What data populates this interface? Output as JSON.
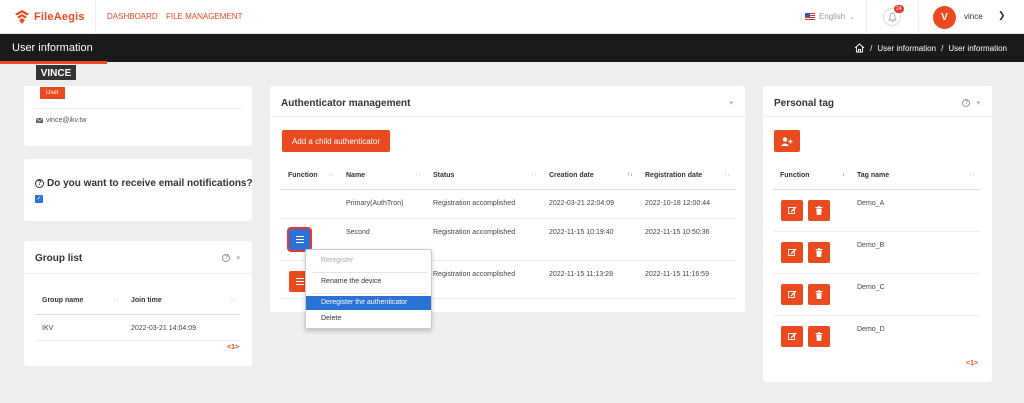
{
  "brand": {
    "name": "FileAegis",
    "accent": "#ea4a1f"
  },
  "nav": {
    "dashboard": "DASHBOARD",
    "file_management": "FILE MANAGEMENT"
  },
  "language": "English",
  "notifications": {
    "count": "24"
  },
  "user": {
    "initial": "V",
    "name": "vince",
    "display": "VINCE",
    "role": "User",
    "email": "vince@ikv.tw"
  },
  "page": {
    "title": "User information",
    "breadcrumb": [
      "User information",
      "User information"
    ]
  },
  "notify": {
    "question": "Do you want to receive email notifications?",
    "checked": true
  },
  "group_list": {
    "title": "Group list",
    "columns": [
      "Group name",
      "Join time"
    ],
    "rows": [
      {
        "name": "IKV",
        "join_time": "2022-03-21 14:04:09"
      }
    ],
    "pager": "<1>"
  },
  "authenticator": {
    "title": "Authenticator management",
    "add_button": "Add a child authenticator",
    "columns": [
      "Function",
      "Name",
      "Status",
      "Creation date",
      "Registration date"
    ],
    "rows": [
      {
        "name": "Primary(AuthTron)",
        "status": "Registration accomplished",
        "created": "2022-03-21 22:04:09",
        "registered": "2022-10-18 12:00:44"
      },
      {
        "name": "Second",
        "status": "Registration accomplished",
        "created": "2022-11-15 10:19:40",
        "registered": "2022-11-15 10:50:36"
      },
      {
        "name": "",
        "status": "Registration accomplished",
        "created": "2022-11-15 11:13:28",
        "registered": "2022-11-15 11:16:59"
      }
    ],
    "menu": {
      "reregister": "Reregister",
      "rename": "Rename the device",
      "deregister": "Deregister the authenticator",
      "delete": "Delete"
    }
  },
  "personal_tag": {
    "title": "Personal tag",
    "columns": [
      "Function",
      "Tag name"
    ],
    "rows": [
      "Demo_A",
      "Demo_B",
      "Demo_C",
      "Demo_D"
    ],
    "pager": "<1>"
  }
}
